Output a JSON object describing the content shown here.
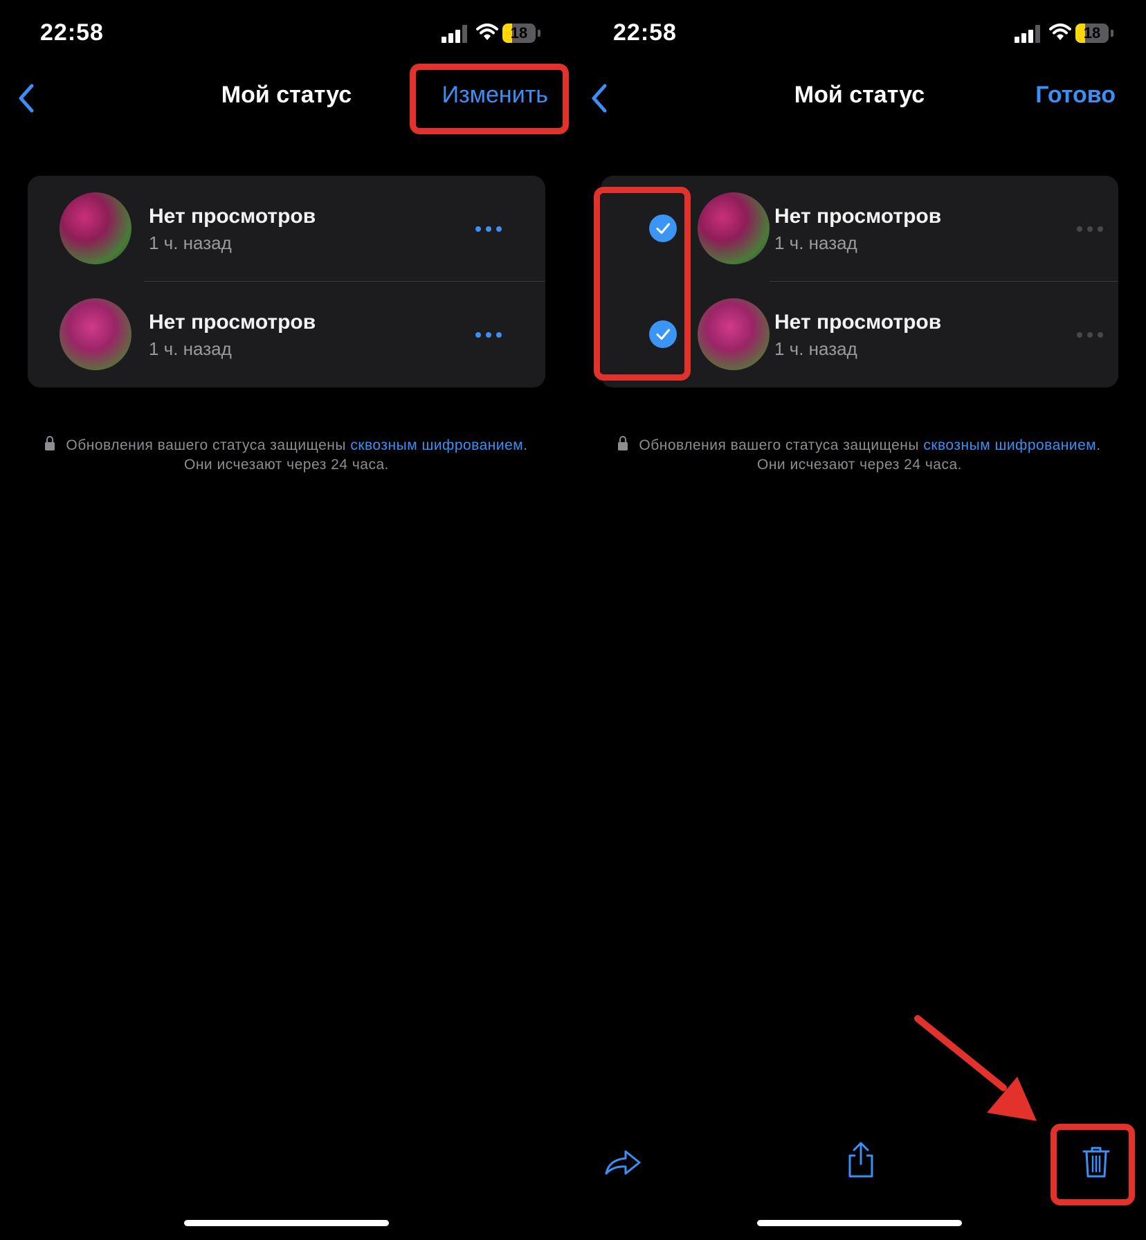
{
  "left_screen": {
    "status_bar": {
      "time": "22:58",
      "battery": "18",
      "battery_level": 0.18
    },
    "nav": {
      "title": "Мой статус",
      "action": "Изменить"
    },
    "statuses": [
      {
        "title": "Нет просмотров",
        "subtitle": "1 ч. назад",
        "more_icon": "ellipsis-icon"
      },
      {
        "title": "Нет просмотров",
        "subtitle": "1 ч. назад",
        "more_icon": "ellipsis-icon"
      }
    ],
    "footer": {
      "text_before": "Обновления вашего статуса защищены ",
      "link": "сквозным шифрованием",
      "text_after": ".",
      "line2": "Они исчезают через 24 часа."
    }
  },
  "right_screen": {
    "status_bar": {
      "time": "22:58",
      "battery": "18",
      "battery_level": 0.18
    },
    "nav": {
      "title": "Мой статус",
      "action": "Готово"
    },
    "statuses": [
      {
        "title": "Нет просмотров",
        "subtitle": "1 ч. назад",
        "selected": true
      },
      {
        "title": "Нет просмотров",
        "subtitle": "1 ч. назад",
        "selected": true
      }
    ],
    "footer": {
      "text_before": "Обновления вашего статуса защищены ",
      "link": "сквозным шифрованием",
      "text_after": ".",
      "line2": "Они исчезают через 24 часа."
    },
    "toolbar": [
      "forward-icon",
      "share-icon",
      "trash-icon"
    ]
  },
  "colors": {
    "accent": "#3b8ff5",
    "annotation": "#e3322c",
    "card": "#1c1c1e",
    "battery": "#ffd60a"
  }
}
